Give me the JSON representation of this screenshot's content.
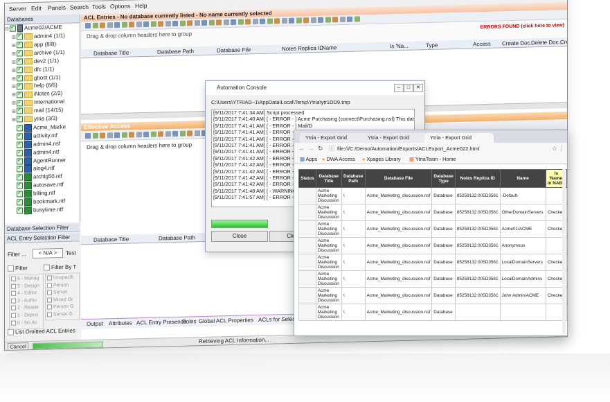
{
  "menu": [
    "Server",
    "Edit",
    "Panels",
    "Search",
    "Tools",
    "Options",
    "Help"
  ],
  "databases_panel": {
    "title": "Databases",
    "root": "Acme02/ACME",
    "items": [
      {
        "label": "admin4 (1/1)",
        "type": "folder"
      },
      {
        "label": "app (8/8)",
        "type": "folder"
      },
      {
        "label": "archive (1/1)",
        "type": "folder"
      },
      {
        "label": "dev2 (1/1)",
        "type": "folder"
      },
      {
        "label": "dfc (1/1)",
        "type": "folder"
      },
      {
        "label": "ghost (1/1)",
        "type": "folder"
      },
      {
        "label": "help (6/6)",
        "type": "folder"
      },
      {
        "label": "iNotes (2/2)",
        "type": "folder"
      },
      {
        "label": "International",
        "type": "folder"
      },
      {
        "label": "mail (14/15)",
        "type": "folder"
      },
      {
        "label": "ytria (3/3)",
        "type": "folder"
      },
      {
        "label": "Acme_Marke",
        "type": "db"
      },
      {
        "label": "activity.ntf",
        "type": "db"
      },
      {
        "label": "admin4.nsf",
        "type": "db"
      },
      {
        "label": "admin4.ntf",
        "type": "db"
      },
      {
        "label": "AgentRunner",
        "type": "db"
      },
      {
        "label": "alog4.ntf",
        "type": "db"
      },
      {
        "label": "archlg50.ntf",
        "type": "dbg"
      },
      {
        "label": "autosave.ntf",
        "type": "dbg"
      },
      {
        "label": "billing.ntf",
        "type": "dbg"
      },
      {
        "label": "bookmark.ntf",
        "type": "dbg"
      },
      {
        "label": "busytime.ntf",
        "type": "dbg"
      }
    ]
  },
  "filters": {
    "db_selection": "Database Selection Filter",
    "acl_entry": "ACL Entry Selection Filter",
    "filter_label": "Filter ...",
    "filter_value": "< N/A >",
    "test_label": "Test",
    "filter_cb": "Filter",
    "filter_by_type": "Filter By T",
    "levels": [
      "6 - Manag",
      "5 - Design",
      "4 - Editor",
      "3 - Autho",
      "2 - Reade",
      "1 - Depos",
      "0 - No Ac"
    ],
    "types": [
      "Unspecifi",
      "Person",
      "Server",
      "Mixed Gr",
      "Person G",
      "Server G"
    ],
    "list_omitted": "List Omitted ACL Entries",
    "cancel": "Cancel"
  },
  "acl_panel": {
    "title": "ACL Entries - No database currently listed - No name currently selected",
    "errors": "ERRORS FOUND (click here to view)",
    "group_hint": "Drag & drop column headers here to group",
    "columns": [
      "Database Title",
      "Database Path",
      "Database File",
      "Notes Replica ID",
      "Name",
      "Is 'Na...",
      "Type",
      "Access",
      "Create Doc...",
      "Delete Doc...",
      "Create"
    ],
    "effective_title": "Effective Access",
    "effective_columns": [
      "Database Title",
      "Database Path"
    ],
    "tabs": [
      "Output",
      "Attributes",
      "ACL Entry Presence",
      "Roles",
      "Global ACL Properties",
      "ACLs for Selected Databa"
    ],
    "status": "Retrieving ACL Information..."
  },
  "automation": {
    "title": "Automation Console",
    "path": "C:\\Users\\YTRIAD~1\\AppData\\Local\\Temp\\Ytria\\ytr1DD9.tmp",
    "log": [
      "[9/11/2017 7:41:34 AM] Script processed",
      "[9/11/2017 7:41:40 AM] [ - ERROR - ] Acme Purchasing (connect\\Purchasing.nsf) This database has local acc",
      "[9/11/2017 7:41:41 AM] [ - ERROR - ] Mail/D",
      "[9/11/2017 7:41:41 AM] [ - ERROR - ] Sour",
      "[9/11/2017 7:41:41 AM] [ - ERROR - ] Sour",
      "[9/11/2017 7:41:41 AM] [ - ERROR - ] Sour",
      "[9/11/2017 7:41:41 AM] [ - ERROR - ] Adm",
      "[9/11/2017 7:41:42 AM] [ - ERROR - ] Kristi",
      "[9/11/2017 7:41:42 AM] [ - ERROR - ] Adm",
      "[9/11/2017 7:41:42 AM] [ - ERROR - ] Mail",
      "[9/11/2017 7:41:42 AM] [ - ERROR - ] prot",
      "[9/11/2017 7:41:42 AM] [ - ERROR - ] Thur",
      "[9/11/2017 7:41:48 AM] [ - WARNING - ] M",
      "[9/11/2017 7:41:57 AM] [ - ERROR - ] Bill S"
    ],
    "close": "Close",
    "clear": "Clear Co"
  },
  "browser": {
    "tabs": [
      "Ytria - Export Grid",
      "Ytria - Export Grid",
      "Ytria - Export Grid"
    ],
    "url": "file:///C:/Demo/Automation/Exports/ACLExport_Acme022.html",
    "bookmarks": [
      "Apps",
      "DWA Access",
      "Xpages Library",
      "YtriaTeam - Home"
    ],
    "columns": [
      "Status",
      "Database Title",
      "Database Path",
      "Database File",
      "Database Type",
      "Notes Replica ID",
      "Name",
      "Is 'Name' in NAB?"
    ],
    "rows": [
      [
        "",
        "Acme Marketing Discussion",
        "\\",
        "Acme_Marketing_discussion.nsf",
        "Database",
        "85258132:005D3561",
        "-Default-",
        ""
      ],
      [
        "",
        "Acme Marketing Discussion",
        "\\",
        "Acme_Marketing_discussion.nsf",
        "Database",
        "85258132:005D3561",
        "OtherDomainServers",
        "Checked"
      ],
      [
        "",
        "Acme Marketing Discussion",
        "\\",
        "Acme_Marketing_discussion.nsf",
        "Database",
        "85258132:005D3561",
        "Acme01/ACME",
        "Checked"
      ],
      [
        "",
        "Acme Marketing Discussion",
        "\\",
        "Acme_Marketing_discussion.nsf",
        "Database",
        "85258132:005D3561",
        "Anonymous",
        ""
      ],
      [
        "",
        "Acme Marketing Discussion",
        "\\",
        "Acme_Marketing_discussion.nsf",
        "Database",
        "85258132:005D3561",
        "LocalDomainServers",
        "Checked"
      ],
      [
        "",
        "Acme Marketing Discussion",
        "\\",
        "Acme_Marketing_discussion.nsf",
        "Database",
        "85258132:005D3561",
        "LocalDomainAdmins",
        "Checked"
      ],
      [
        "",
        "Acme Marketing Discussion",
        "\\",
        "Acme_Marketing_discussion.nsf",
        "Database",
        "85258132:005D3561",
        "John Admin/ACME",
        "Checked"
      ],
      [
        "",
        "Acme Marketing Discussion",
        "\\",
        "Acme_Marketing_discussion.nsf",
        "Database",
        "",
        "",
        ""
      ]
    ]
  }
}
